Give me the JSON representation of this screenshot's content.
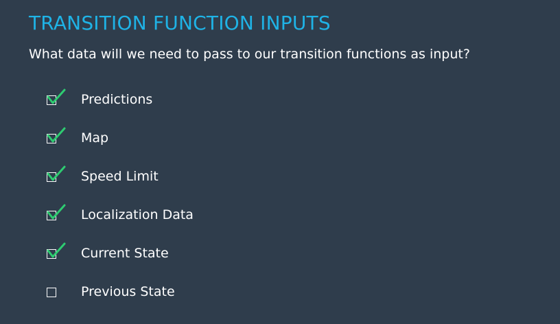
{
  "slide": {
    "title": "TRANSITION FUNCTION INPUTS",
    "question": "What data will we need to pass to our transition functions as input?"
  },
  "checklist": {
    "items": [
      {
        "label": "Predictions",
        "checked": true
      },
      {
        "label": "Map",
        "checked": true
      },
      {
        "label": "Speed Limit",
        "checked": true
      },
      {
        "label": "Localization Data",
        "checked": true
      },
      {
        "label": "Current State",
        "checked": true
      },
      {
        "label": "Previous State",
        "checked": false
      }
    ]
  },
  "colors": {
    "background": "#2f3d4c",
    "title": "#1fb3e6",
    "text": "#ffffff",
    "checkmark": "#2ecc71"
  }
}
